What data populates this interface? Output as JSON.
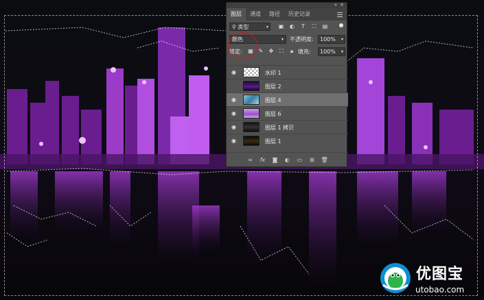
{
  "panel": {
    "tabs": [
      "图层",
      "通道",
      "路径",
      "历史记录"
    ],
    "filter_label": "类型",
    "blend_mode": "颜色",
    "opacity_label": "不透明度:",
    "opacity_value": "100%",
    "lock_label": "锁定:",
    "fill_label": "填充:",
    "fill_value": "100%"
  },
  "layers": [
    {
      "name": "水印 1",
      "visible": true
    },
    {
      "name": "图层 2",
      "visible": false
    },
    {
      "name": "图层 4",
      "visible": true,
      "selected": true
    },
    {
      "name": "图层 6",
      "visible": true
    },
    {
      "name": "图层 1 拷贝",
      "visible": true
    },
    {
      "name": "图层 1",
      "visible": true
    }
  ],
  "watermark": {
    "name": "优图宝",
    "url": "utobao.com"
  },
  "colors": {
    "panel_bg": "#535353",
    "accent_purple": "#b03ae0",
    "annotation_red": "#d11a1a"
  }
}
